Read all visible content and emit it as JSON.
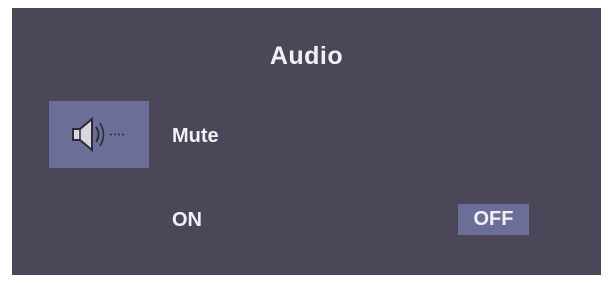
{
  "osd": {
    "title": "Audio",
    "menu_item_icon": "speaker-icon",
    "menu_item_label": "Mute",
    "options": [
      {
        "label": "ON",
        "selected": false
      },
      {
        "label": "OFF",
        "selected": true
      }
    ]
  },
  "colors": {
    "background": "#4b4658",
    "highlight": "#6b6f97",
    "text": "#f2f0f6"
  }
}
